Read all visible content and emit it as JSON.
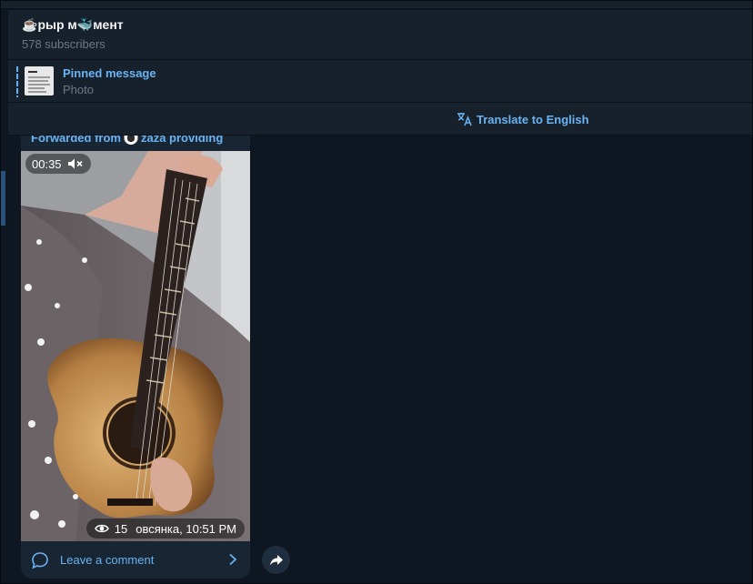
{
  "channel": {
    "title_prefix_icon": "coffee-cup-emoji",
    "title_part1": "рыр м",
    "title_mid_icon": "whale-emoji",
    "title_part2": "мент",
    "subscribers": "578 subscribers"
  },
  "pinned": {
    "title": "Pinned message",
    "subtitle": "Photo"
  },
  "translate": {
    "label": "Translate to English",
    "icon": "translate-icon"
  },
  "message": {
    "forwarded_prefix": "Forwarded from",
    "forwarded_name": "zaza providing",
    "video": {
      "duration": "00:35",
      "sound": "muted"
    },
    "views": "15",
    "author": "овсянка",
    "time": "10:51 PM",
    "meta_text": "овсянка, 10:51 PM",
    "comment_label": "Leave a comment"
  },
  "colors": {
    "background": "#0e1621",
    "panel": "#17212b",
    "bubble": "#182533",
    "accent": "#6ab3f3",
    "muted_text": "#6d7883"
  }
}
